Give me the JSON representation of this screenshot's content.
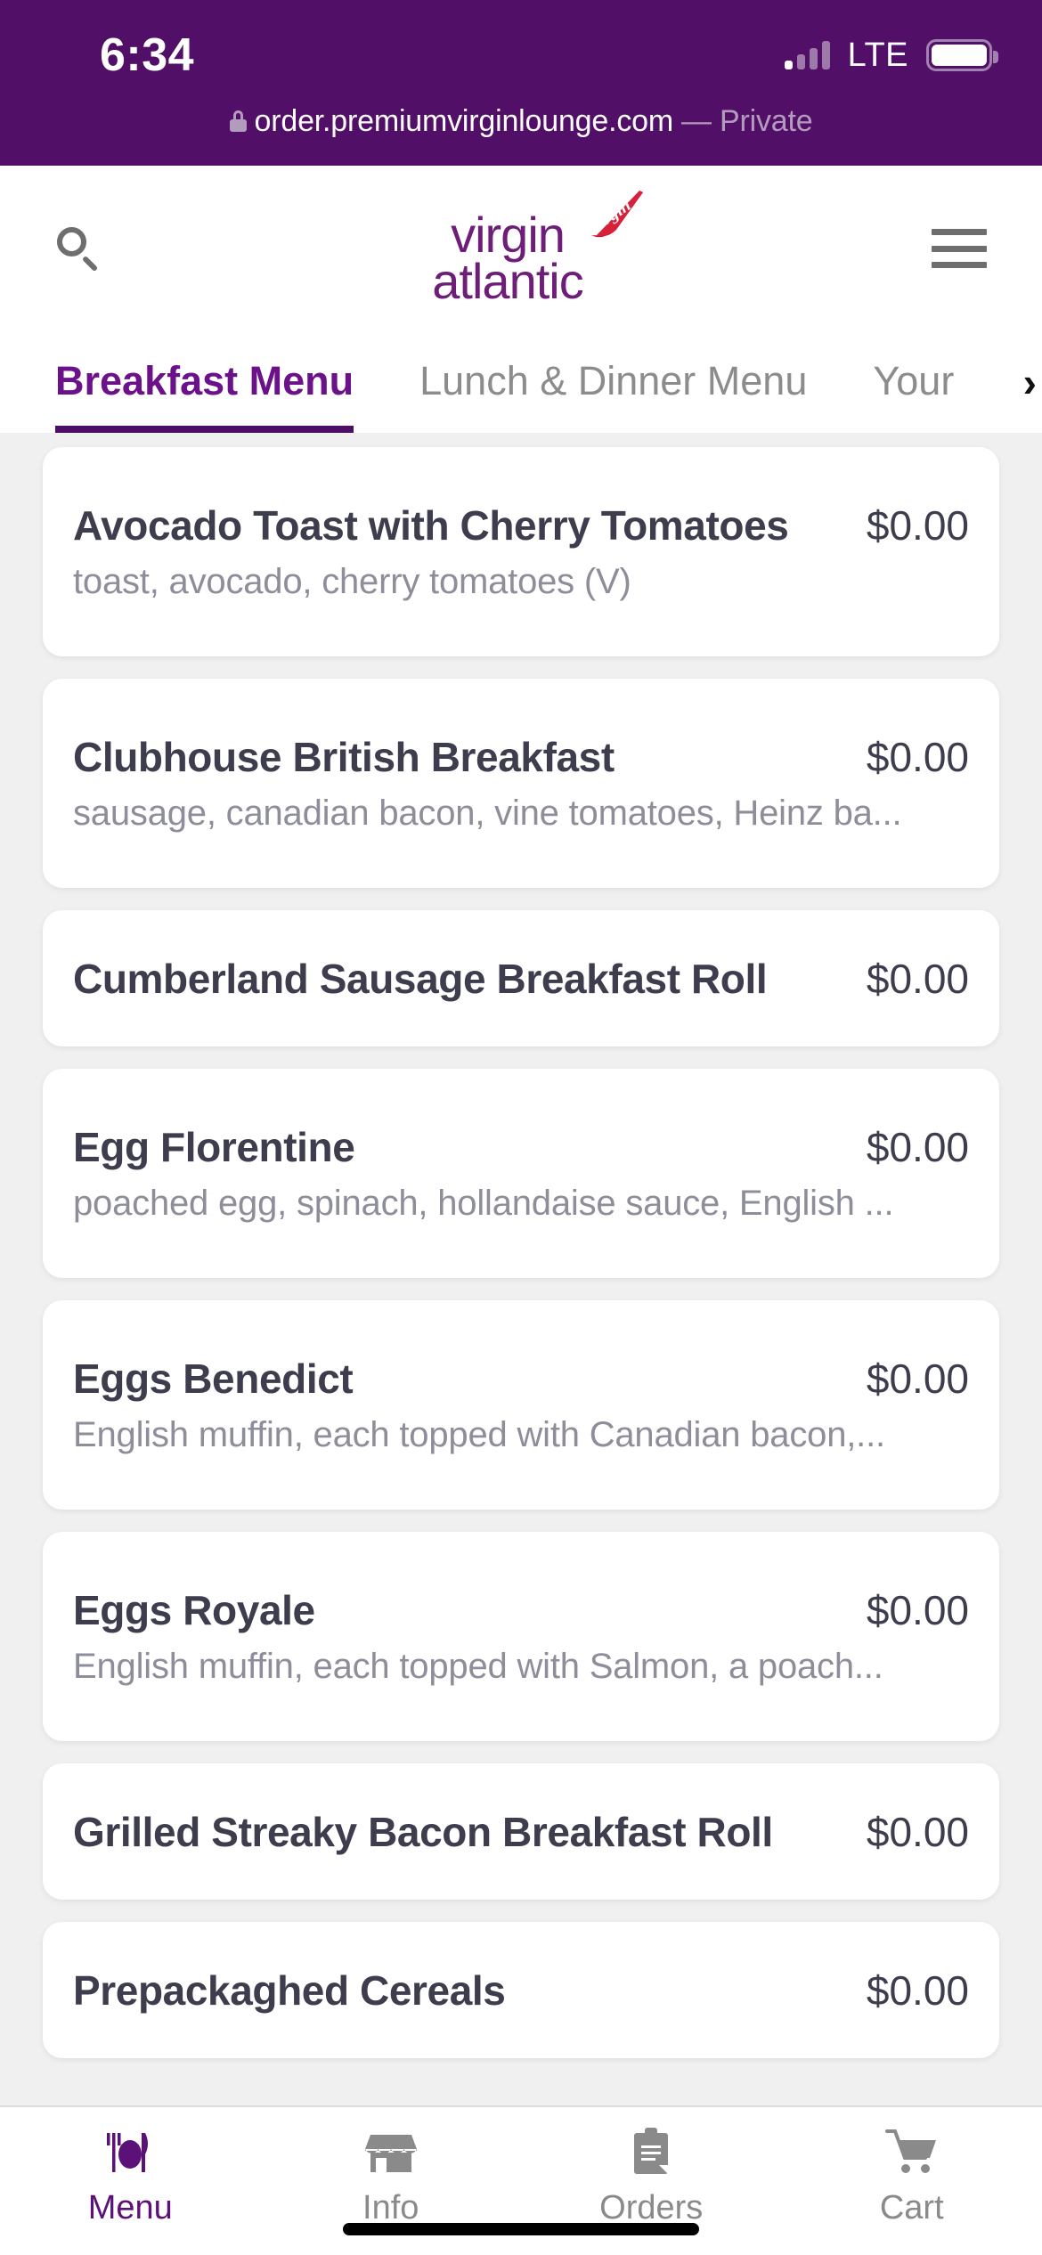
{
  "status_bar": {
    "time": "6:34",
    "network_label": "LTE",
    "signal_icon": "signal-bars-icon",
    "battery_icon": "battery-full-icon"
  },
  "browser": {
    "lock_icon": "lock-icon",
    "url": "order.premiumvirginlounge.com",
    "privacy_label": "— Private"
  },
  "header": {
    "search_icon": "search-icon",
    "menu_icon": "hamburger-menu-icon",
    "logo": {
      "line1": "virgin",
      "line2": "atlantic",
      "tailfin_text": "Virgin",
      "tailfin_color": "#CC122B",
      "wordmark_color": "#6E1E78"
    }
  },
  "tabs": {
    "items": [
      {
        "label": "Breakfast Menu",
        "active": true
      },
      {
        "label": "Lunch & Dinner Menu",
        "active": false
      },
      {
        "label": "Your",
        "active": false
      }
    ],
    "overflow_chevron": "›",
    "active_color": "#6B1189",
    "inactive_color": "#8C8C8C",
    "underline_color": "#4E0E66"
  },
  "menu_items": [
    {
      "name": "Avocado Toast with Cherry Tomatoes",
      "price": "$0.00",
      "description": "toast, avocado, cherry tomatoes (V)"
    },
    {
      "name": "Clubhouse British Breakfast",
      "price": "$0.00",
      "description": "sausage, canadian bacon, vine tomatoes, Heinz ba..."
    },
    {
      "name": "Cumberland Sausage Breakfast Roll",
      "price": "$0.00",
      "description": ""
    },
    {
      "name": "Egg Florentine",
      "price": "$0.00",
      "description": "poached egg, spinach, hollandaise sauce, English ..."
    },
    {
      "name": "Eggs Benedict",
      "price": "$0.00",
      "description": "English muffin, each topped with Canadian bacon,..."
    },
    {
      "name": "Eggs Royale",
      "price": "$0.00",
      "description": "English muffin, each topped with Salmon, a poach..."
    },
    {
      "name": "Grilled Streaky Bacon Breakfast Roll",
      "price": "$0.00",
      "description": ""
    },
    {
      "name": "Prepackaghed Cereals",
      "price": "$0.00",
      "description": ""
    }
  ],
  "bottom_nav": {
    "items": [
      {
        "label": "Menu",
        "icon": "cutlery-plate-icon",
        "active": true
      },
      {
        "label": "Info",
        "icon": "storefront-icon",
        "active": false
      },
      {
        "label": "Orders",
        "icon": "clipboard-icon",
        "active": false
      },
      {
        "label": "Cart",
        "icon": "shopping-cart-icon",
        "active": false
      }
    ],
    "active_color": "#5C1178",
    "inactive_color": "#8A8A8A"
  },
  "theme": {
    "chrome_purple": "#510F68",
    "page_background": "#F0F0F0",
    "card_background": "#FFFFFF",
    "title_color": "#3D3D4E",
    "description_color": "#8E8E9B"
  }
}
